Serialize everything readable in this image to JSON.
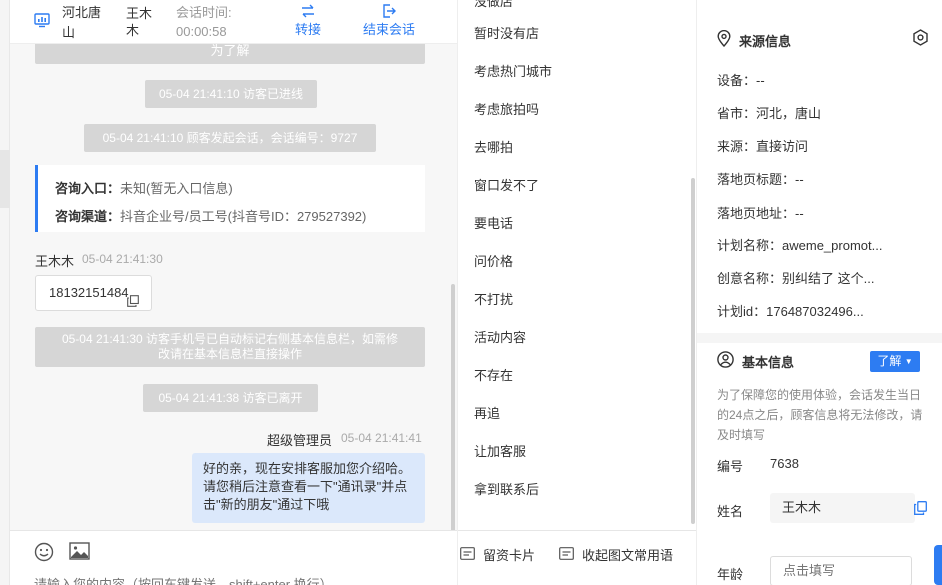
{
  "header": {
    "region_line1": "河北唐",
    "region_line2": "山",
    "visitor_line1": "王木",
    "visitor_line2": "木",
    "session_time_label": "会话时间:",
    "session_time_value": "00:00:58",
    "transfer_label": "转接",
    "end_label": "结束会话"
  },
  "chat": {
    "top_partial": "为了解",
    "sys_enter": "05-04 21:41:10 访客已进线",
    "sys_start": "05-04 21:41:10 顾客发起会话，会话编号：9727",
    "info_card": {
      "entry_label": "咨询入口：",
      "entry_value": "未知(暂无入口信息)",
      "channel_label": "咨询渠道：",
      "channel_value": "抖音企业号/员工号(抖音号ID：279527392)"
    },
    "visitor_name": "王木木",
    "visitor_time": "05-04 21:41:30",
    "visitor_phone": "18132151484",
    "sys_phone_line1": "05-04 21:41:30 访客手机号已自动标记右侧基本信息栏，如需修",
    "sys_phone_line2": "改请在基本信息栏直接操作",
    "sys_leave": "05-04 21:41:38 访客已离开",
    "admin_name": "超级管理员",
    "admin_time": "05-04 21:41:41",
    "agent_msg_line1": "好的亲，现在安排客服加您介绍哈。",
    "agent_msg_line2": "请您稍后注意查看一下\"通讯录\"并点",
    "agent_msg_line3": "击\"新的朋友\"通过下哦",
    "input_placeholder": "请输入您的内容（按回车键发送，shift+enter 换行）"
  },
  "quick_replies": {
    "top_partial": "没做店",
    "items": [
      "暂时没有店",
      "考虑热门城市",
      "考虑旅拍吗",
      "去哪拍",
      "窗口发不了",
      "要电话",
      "问价格",
      "不打扰",
      "活动内容",
      "不存在",
      "再追",
      "让加客服",
      "拿到联系后"
    ],
    "card_label": "留资卡片",
    "collect_label": "收起图文常用语"
  },
  "info_panel": {
    "source_title": "来源信息",
    "rows": [
      {
        "k": "设备：",
        "v": "--"
      },
      {
        "k": "省市：",
        "v": "河北，唐山"
      },
      {
        "k": "来源：",
        "v": "直接访问"
      },
      {
        "k": "落地页标题：",
        "v": "--"
      },
      {
        "k": "落地页地址：",
        "v": "--"
      },
      {
        "k": "计划名称：",
        "v": "aweme_promot..."
      },
      {
        "k": "创意名称：",
        "v": "别纠结了 这个..."
      },
      {
        "k": "计划id：",
        "v": "176487032496..."
      }
    ],
    "basic_title": "基本信息",
    "learn_label": "了解",
    "hint_line1": "为了保障您的使用体验，会话发生当日",
    "hint_line2": "的24点之后，顾客信息将无法修改，请",
    "hint_line3": "及时填写",
    "id_label": "编号",
    "id_value": "7638",
    "name_label": "姓名",
    "name_value": "王木木",
    "age_label": "年龄",
    "age_placeholder": "点击填写"
  },
  "colors": {
    "accent": "#2d7cf2",
    "system_message_bg": "#d6d6d6",
    "agent_bubble_bg": "#dbe8fb"
  }
}
